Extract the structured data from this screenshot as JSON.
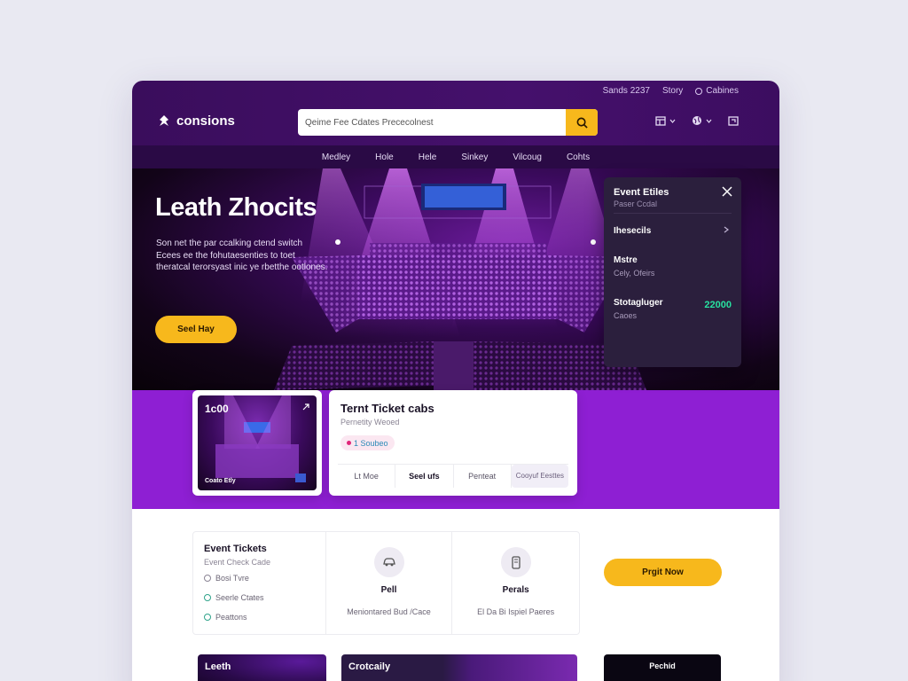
{
  "header": {
    "util_links": [
      "Sands 2237",
      "Story",
      "Cabines"
    ],
    "logo_text": "consions",
    "search_placeholder": "Qeime    Fee Cdates    Prececolnest",
    "nav": [
      "Medley",
      "Hole",
      "Hele",
      "Sinkey",
      "Vilcoug",
      "Cohts"
    ]
  },
  "hero": {
    "title": "Leath Zhocits",
    "description": "Son net the par ccalking ctend switch Ecees ee the fohutaesenties to toet theratcal terorsyast inic ye rbetthe ootlones.",
    "cta_label": "Seel Hay"
  },
  "panel": {
    "title": "Event Etiles",
    "subtitle": "Paser Ccdal",
    "rows": [
      {
        "label": "Ihesecils",
        "sub": ""
      },
      {
        "label": "Mstre",
        "sub": "Cely, Ofeirs"
      },
      {
        "label": "Stotagluger",
        "sub": "Caoes",
        "price": "22000"
      }
    ]
  },
  "card_image": {
    "number": "1c00",
    "caption": "Coato Etly"
  },
  "card_info": {
    "title": "Ternt Ticket cabs",
    "subtitle": "Pernetity Weoed",
    "badge": "1 Soubeo",
    "tabs": [
      "Lt Moe",
      "Seel ufs",
      "Penteat",
      "Cooyuf Eesttes"
    ]
  },
  "feature": {
    "title": "Event Tickets",
    "subtitle": "Event Check Cade",
    "items": [
      "Bosi Tvre",
      "Seerle Ctates",
      "Peattons"
    ],
    "col2": {
      "label": "Pell",
      "small": "Meniontared Bud /Cace"
    },
    "col3": {
      "label": "Perals",
      "small": "El Da Bi Ispiel Paeres"
    }
  },
  "order_button": "Prgit Now",
  "tiles": [
    "Leeth",
    "Crotcaily",
    "Pechid"
  ],
  "colors": {
    "accent": "#f7b81c",
    "brand_purple": "#8e1fd3",
    "dark": "#3a0d5c"
  }
}
